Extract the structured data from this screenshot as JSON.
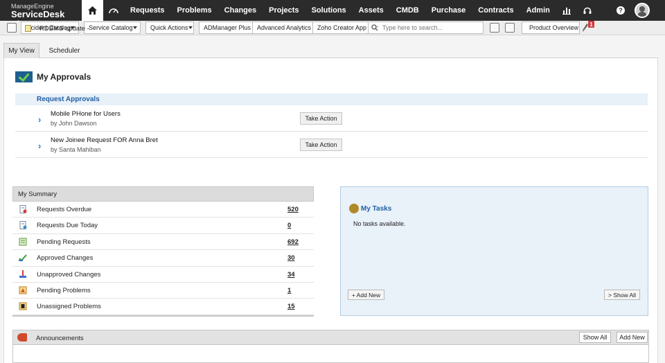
{
  "brand": {
    "line1": "ManageEngine",
    "line2": "ServiceDesk Plus"
  },
  "nav": [
    "Requests",
    "Problems",
    "Changes",
    "Projects",
    "Solutions",
    "Assets",
    "CMDB",
    "Purchase",
    "Contracts",
    "Admin"
  ],
  "help_glyph": "?",
  "toolbar": {
    "incident_catalog": "Incident Catalog",
    "service_catalog": "Service Catalog",
    "quick_actions": "Quick Actions",
    "admanager": "ADManager Plus",
    "advanced_analytics": "Advanced Analytics",
    "zoho_creator": "Zoho Creator App",
    "search_placeholder": "Type here to search...",
    "product_overview": "Product Overview",
    "notification_count": "1"
  },
  "tabs": {
    "my_view": "My View",
    "scheduler": "Scheduler"
  },
  "approvals": {
    "title": "My Approvals",
    "section": "Request Approvals",
    "items": [
      {
        "title": "Mobile PHone for Users",
        "by": "by John Dawson",
        "action": "Take Action"
      },
      {
        "title": "New Joinee Request FOR Anna Bret",
        "by": "by Santa Mahiban",
        "action": "Take Action"
      }
    ]
  },
  "summary": {
    "title": "My Summary",
    "rows": [
      {
        "label": "Requests Overdue",
        "value": "520"
      },
      {
        "label": "Requests Due Today",
        "value": "0"
      },
      {
        "label": "Pending Requests",
        "value": "692"
      },
      {
        "label": "Approved Changes",
        "value": "30"
      },
      {
        "label": "Unapproved Changes",
        "value": "34"
      },
      {
        "label": "Pending Problems",
        "value": "1"
      },
      {
        "label": "Unassigned Problems",
        "value": "15"
      }
    ]
  },
  "tasks": {
    "title": "My Tasks",
    "empty": "No tasks available.",
    "add_new": "+ Add New",
    "show_all": "> Show All"
  },
  "announcements": {
    "title": "Announcements",
    "show_all": "Show All",
    "add_new": "Add New",
    "item": "RDBMS update -"
  }
}
